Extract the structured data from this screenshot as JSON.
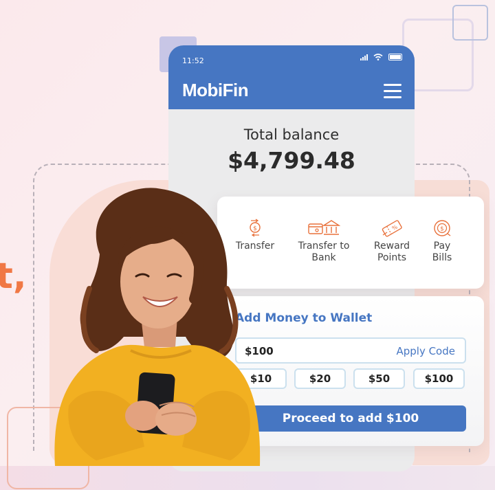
{
  "status_bar": {
    "time": "11:52"
  },
  "header": {
    "brand": "MobiFin"
  },
  "balance": {
    "label": "Total balance",
    "value": "$4,799.48"
  },
  "decor": {
    "comma": "t,"
  },
  "actions": [
    {
      "label_line1": "Transfer",
      "label_line2": "",
      "icon": "money-transfer-icon"
    },
    {
      "label_line1": "Transfer to",
      "label_line2": "Bank",
      "icon": "bank-transfer-icon"
    },
    {
      "label_line1": "Reward",
      "label_line2": "Points",
      "icon": "reward-ticket-icon"
    },
    {
      "label_line1": "Pay",
      "label_line2": "Bills",
      "icon": "pay-bill-icon"
    }
  ],
  "wallet": {
    "title": "Add Money to Wallet",
    "amount": "$100",
    "apply_code": "Apply Code",
    "chips": [
      "$10",
      "$20",
      "$50",
      "$100"
    ],
    "proceed": "Proceed to add $100"
  },
  "colors": {
    "brand_blue": "#4676c2",
    "accent_orange": "#f07845",
    "shirt_yellow": "#f2b021"
  }
}
